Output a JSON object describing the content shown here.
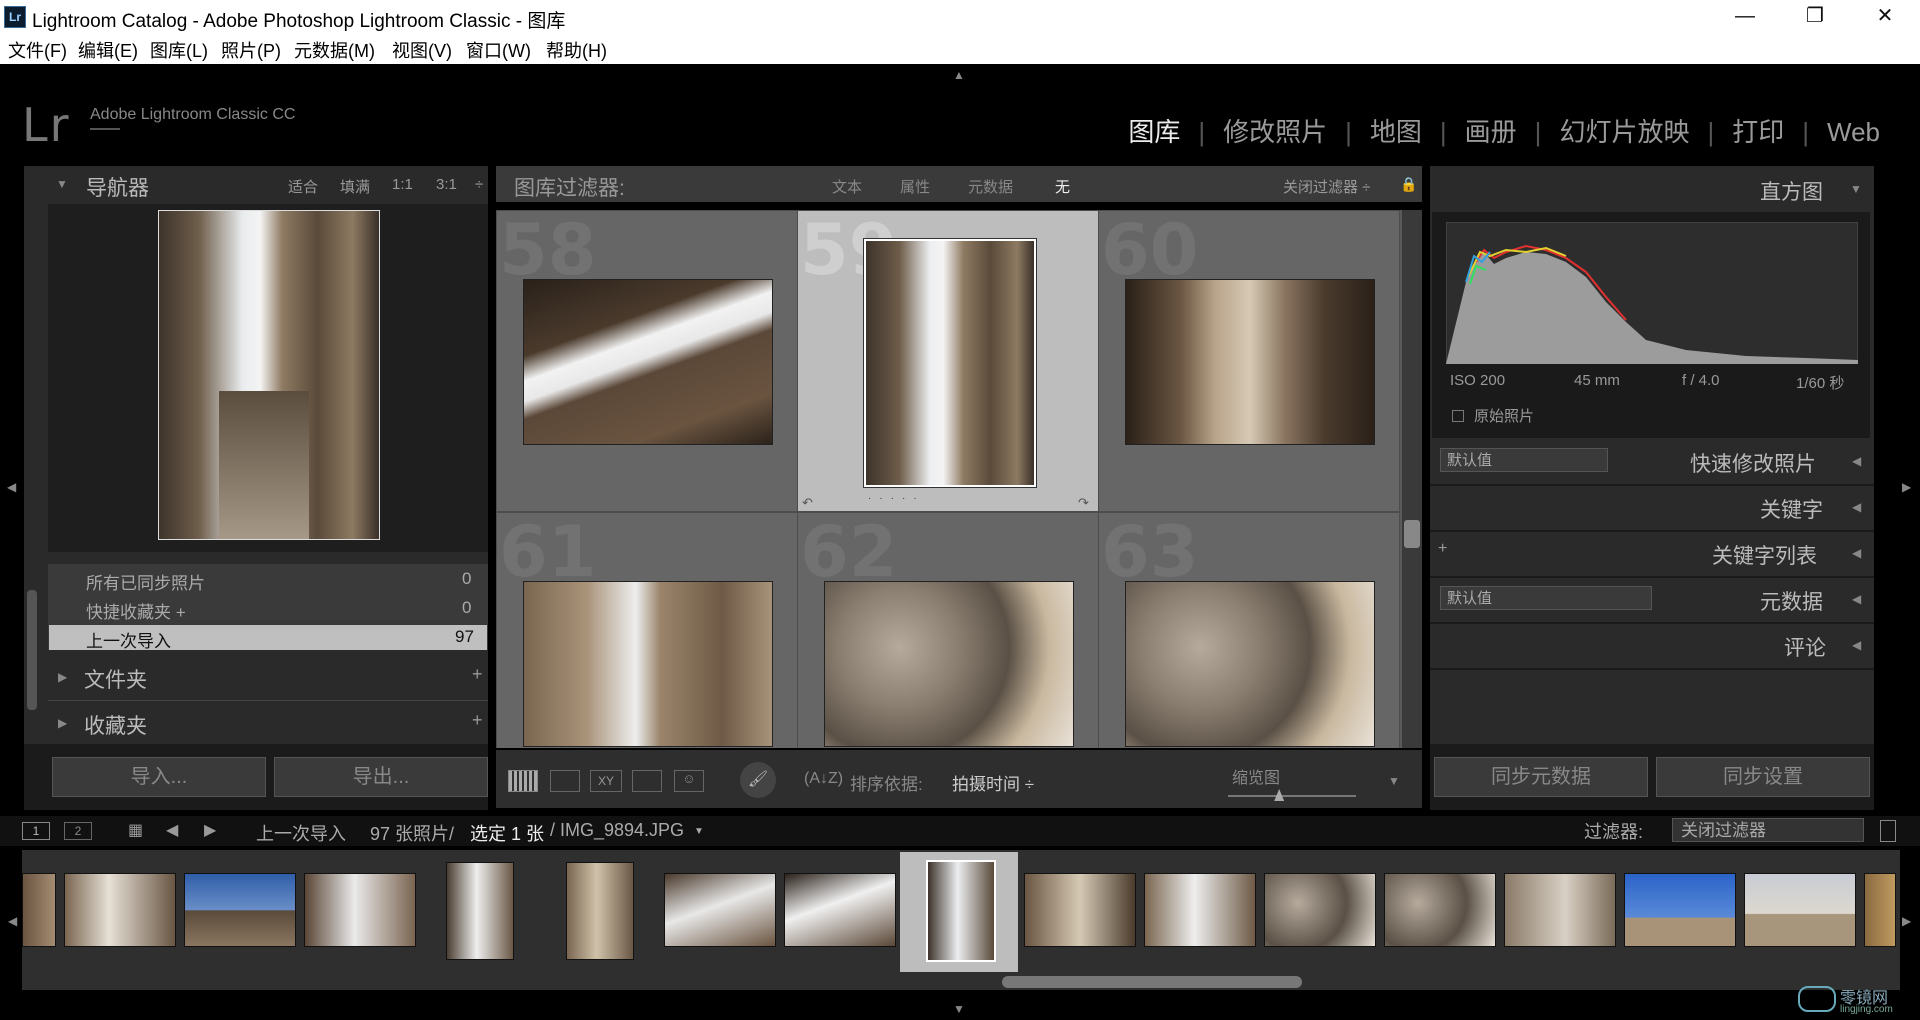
{
  "window": {
    "title": "Lightroom Catalog - Adobe Photoshop Lightroom Classic - 图库",
    "app_icon": "Lr",
    "controls": {
      "minimize": "—",
      "maximize": "❐",
      "close": "✕"
    }
  },
  "menu": [
    "文件(F)",
    "编辑(E)",
    "图库(L)",
    "照片(P)",
    "元数据(M)",
    "视图(V)",
    "窗口(W)",
    "帮助(H)"
  ],
  "identity": {
    "logo": "Lr",
    "app_name": "Adobe Lightroom Classic CC"
  },
  "modules": [
    "图库",
    "修改照片",
    "地图",
    "画册",
    "幻灯片放映",
    "打印",
    "Web"
  ],
  "active_module": "图库",
  "navigator": {
    "title": "导航器",
    "zoom_options": [
      "适合",
      "填满",
      "1:1",
      "3:1"
    ]
  },
  "catalog": [
    {
      "label": "所有已同步照片",
      "count": "0"
    },
    {
      "label": "快捷收藏夹 +",
      "count": "0"
    },
    {
      "label": "上一次导入",
      "count": "97"
    }
  ],
  "folders": {
    "label": "文件夹",
    "add": "+"
  },
  "collections": {
    "label": "收藏夹",
    "add": "+"
  },
  "left_buttons": {
    "import": "导入...",
    "export": "导出..."
  },
  "filter_bar": {
    "label": "图库过滤器:",
    "options": [
      "文本",
      "属性",
      "元数据",
      "无"
    ],
    "preset": "关闭过滤器 ÷"
  },
  "grid": [
    {
      "number": "58",
      "selected": false
    },
    {
      "number": "59",
      "selected": true
    },
    {
      "number": "60",
      "selected": false
    },
    {
      "number": "61",
      "selected": false
    },
    {
      "number": "62",
      "selected": false
    },
    {
      "number": "63",
      "selected": false
    }
  ],
  "toolbar": {
    "sort_label": "排序依据:",
    "sort_value": "拍摄时间 ÷",
    "thumbnail_label": "缩览图",
    "thumbnail_size": 0.4
  },
  "histogram": {
    "title": "直方图",
    "iso": "ISO 200",
    "focal": "45 mm",
    "aperture": "f / 4.0",
    "shutter": "1/60 秒",
    "original_photo": "原始照片"
  },
  "right_panels": {
    "quick_develop": "快速修改照片",
    "quick_preset": "默认值",
    "keywords": "关键字",
    "keyword_list": "关键字列表",
    "metadata": "元数据",
    "metadata_preset": "默认值",
    "comments": "评论",
    "sync_metadata": "同步元数据",
    "sync_settings": "同步设置"
  },
  "filmstrip_bar": {
    "page1": "1",
    "page2": "2",
    "source": "上一次导入",
    "count": "97 张照片/",
    "selected": "选定 1 张",
    "filename": "/ IMG_9894.JPG",
    "filter_label": "过滤器:",
    "filter_value": "关闭过滤器"
  },
  "watermark": {
    "text": "零镜网",
    "sub": "lingjing.com"
  },
  "colors": {
    "bg": "#000000",
    "panel": "#2a2a2a",
    "grid": "#666666",
    "selected_cell": "#bdbdbd"
  }
}
